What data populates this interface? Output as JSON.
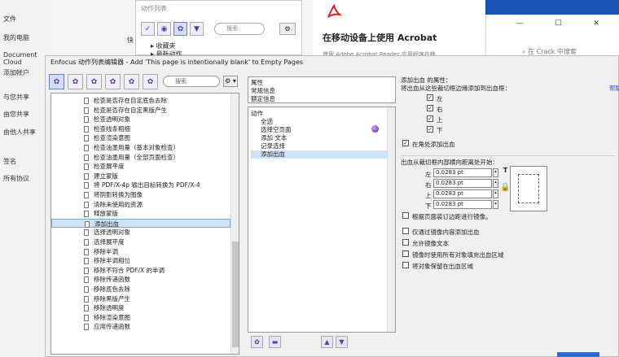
{
  "sidebar": {
    "items": [
      {
        "label": "文件"
      },
      {
        "label": "我的电脑"
      },
      {
        "label": "Document Cloud"
      },
      {
        "label": "添加帐户"
      },
      {
        "label": "与您共享"
      },
      {
        "label": "由您共享"
      },
      {
        "label": "由他人共享"
      },
      {
        "label": "签名"
      },
      {
        "label": "所有协议"
      }
    ]
  },
  "bg_actions": {
    "title": "动作列表",
    "search_placeholder": "搜索",
    "row1": "收藏夹",
    "row2": "最新动作",
    "label_fragment": "快"
  },
  "bg_mobile": {
    "heading": "在移动设备上使用 Acrobat",
    "subtext": "使用 Adobe Acrobat Reader 应用程序在移"
  },
  "bg_window": {
    "search_text": "在 Crack 中搜索",
    "controls": "— ☐ ✕"
  },
  "editor": {
    "title": "Enfocus 动作列表编辑器 - Add 'This page is intentionally blank' to Empty Pages",
    "search_placeholder": "搜索",
    "gear_label": "⚙ ▾",
    "list_items": [
      "检查是否存在自定底色去除",
      "检查是否存在自定黑版产生",
      "检查透明对象",
      "检查线条粗细",
      "检查渲染意图",
      "检查油墨用量（基本对象检查）",
      "检查油墨用量（全部页面检查）",
      "检查展平度",
      "建立蒙版",
      "将 PDF/X-4p 输出目标转换为 PDF/X-4",
      "将阴影转换为图像",
      "清除未使用的资源",
      "释放蒙版",
      "添加出血",
      "选择透明对象",
      "选择展平度",
      "移除半调",
      "移除半调相位",
      "移除不符合 PDF/X 的半调",
      "移除传递函数",
      "移除底色去除",
      "移除黑版产生",
      "移除透明度",
      "移除渲染意图",
      "应用传递函数"
    ],
    "selected_index": 13,
    "middle_top": [
      "属性",
      "常规信息",
      "额定信息"
    ],
    "middle_items": [
      {
        "label": "动作",
        "indent": false,
        "selected": false
      },
      {
        "label": "全选",
        "indent": true,
        "selected": false
      },
      {
        "label": "选择空页面",
        "indent": true,
        "selected": false
      },
      {
        "label": "添加 文本",
        "indent": true,
        "selected": false
      },
      {
        "label": "记录选择",
        "indent": true,
        "selected": false
      },
      {
        "label": "添加出血",
        "indent": true,
        "selected": true
      }
    ]
  },
  "props": {
    "heading": "添加出血 的属性：",
    "help_link": "帮助",
    "instruction": "将出血从这些裁切框边缘添加到出血框：",
    "edges": [
      {
        "label": "左",
        "checked": true
      },
      {
        "label": "右",
        "checked": true
      },
      {
        "label": "上",
        "checked": true
      },
      {
        "label": "下",
        "checked": true
      }
    ],
    "corner_label": "在角处添加出血",
    "corner_checked": true,
    "distance_label": "出血从裁切框内部横向距离处开始：",
    "fields": [
      {
        "label": "左",
        "value": "0.0283 pt"
      },
      {
        "label": "右",
        "value": "0.0283 pt"
      },
      {
        "label": "上",
        "value": "0.0283 pt"
      },
      {
        "label": "下",
        "value": "0.0283 pt"
      }
    ],
    "options": [
      {
        "label": "根据页面装订边距进行镜像。",
        "checked": false
      },
      {
        "label": "仅通过镜像内容添加出血",
        "checked": false
      },
      {
        "label": "允许镜像文本",
        "checked": false
      },
      {
        "label": "镜像时使用所有对象填充出血区域",
        "checked": false
      },
      {
        "label": "将对象保留在出血区域",
        "checked": false
      }
    ],
    "checkmark": "✓",
    "diagram_letter": "T"
  },
  "colors": {
    "selection": "#cde3f8",
    "accent": "#1a56b5",
    "icon": "#5a3d9a"
  }
}
